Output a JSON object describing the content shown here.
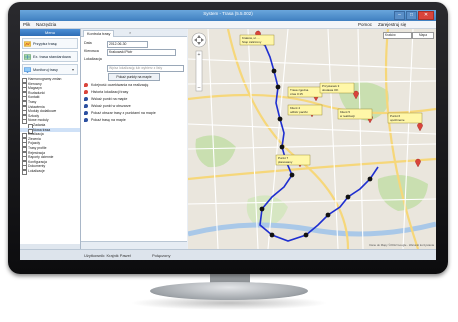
{
  "window": {
    "title": "System - Trasa (5.5.002)"
  },
  "menu": {
    "items": [
      "Plik",
      "Narzędzia"
    ],
    "right": [
      "Pomoc",
      "Zarejestruj się"
    ]
  },
  "left_panel": {
    "header": "Menu",
    "buttons": [
      {
        "label": "Przypisz trasę",
        "icon": "route-icon"
      },
      {
        "label": "Ex. trasa standardowa",
        "icon": "map-icon"
      },
      {
        "label": "Monitoruj trasy",
        "icon": "monitor-icon"
      }
    ],
    "tree": [
      {
        "label": "Harmonogramy zmian",
        "level": 0,
        "selected": false
      },
      {
        "label": "Kierowcy",
        "level": 0,
        "selected": false
      },
      {
        "label": "Magazyn",
        "level": 0,
        "selected": false
      },
      {
        "label": "Rozładunki",
        "level": 0,
        "selected": false
      },
      {
        "label": "Kontakt",
        "level": 0,
        "selected": false
      },
      {
        "label": "Trasy",
        "level": 0,
        "selected": false
      },
      {
        "label": "Ustawienia",
        "level": 0,
        "selected": false
      },
      {
        "label": "Moduły dodatkowe",
        "level": 0,
        "selected": false
      },
      {
        "label": "Szkody",
        "level": 0,
        "selected": false
      },
      {
        "label": "Nowe moduły",
        "level": 0,
        "selected": false
      },
      {
        "label": "Zadania",
        "level": 1,
        "selected": false
      },
      {
        "label": "Nowa trasa",
        "level": 1,
        "selected": true
      },
      {
        "label": "Realizacja",
        "level": 0,
        "selected": false
      },
      {
        "label": "Zlecenia",
        "level": 0,
        "selected": false
      },
      {
        "label": "Pojazdy",
        "level": 0,
        "selected": false
      },
      {
        "label": "Trasy profile",
        "level": 0,
        "selected": false
      },
      {
        "label": "Rejestracja",
        "level": 0,
        "selected": false
      },
      {
        "label": "Raporty dziennie",
        "level": 0,
        "selected": false
      },
      {
        "label": "Konfiguracja",
        "level": 0,
        "selected": false
      },
      {
        "label": "Dokumenty",
        "level": 0,
        "selected": false
      },
      {
        "label": "Lokalizacje",
        "level": 0,
        "selected": false
      }
    ]
  },
  "middle_panel": {
    "tab": "Kontrola trasy",
    "form": [
      {
        "label": "Data",
        "value": "2012-06-30"
      },
      {
        "label": "Kierowca",
        "value": "Krakowski Piotr"
      },
      {
        "label": "Lokalizacja",
        "value": ""
      }
    ],
    "search_placeholder": "Wpisz lokalizację lub wybierz z listy",
    "action_button": "Pokaż punkty na mapie",
    "pick_options": [
      {
        "label": "Kolejność oczekiwania na realizację",
        "color": "#d9443b"
      },
      {
        "label": "Historia lokalizacji trasy",
        "color": "#d9443b"
      },
      {
        "label": "Wskaż punkt na mapie",
        "color": "#2b4fa0"
      },
      {
        "label": "Wskaż punkt w obszarze",
        "color": "#2b4fa0"
      },
      {
        "label": "Pokaż obszar trasy z punktami na mapie",
        "color": "#2b4fa0"
      },
      {
        "label": "Pokaż trasę na mapie",
        "color": "#2b4fa0"
      }
    ]
  },
  "map": {
    "search_text": "Kraków",
    "type_label": "Mapa",
    "credit": "Dane do Mapy ©2012 Google - Warunki korzystania",
    "route_color": "#1f2fd0",
    "popups": [
      {
        "line1": "Kraków, ul. ...",
        "line2": "Stop zaliczony"
      },
      {
        "line1": "Trasa zgodna",
        "line2": "czas 0:15"
      },
      {
        "line1": "Przystanek 3",
        "line2": "dostawa OK"
      },
      {
        "line1": "Klient 4",
        "line2": "odbiór paczki"
      },
      {
        "line1": "Klient 5",
        "line2": "w realizacji"
      },
      {
        "line1": "Punkt 6",
        "line2": "opóźnienie"
      },
      {
        "line1": "Punkt 7",
        "line2": "planowany"
      }
    ]
  },
  "statusbar": {
    "left": "Użytkownik: Krajnik Paweł",
    "right": "Połączony"
  }
}
